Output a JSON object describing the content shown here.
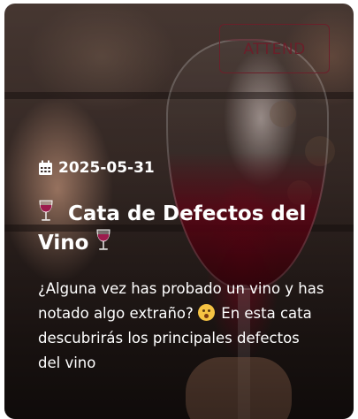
{
  "event": {
    "attend_label": "ATTEND",
    "date": "2025-05-31",
    "title_text": "Cata de Defectos del Vino",
    "description_part1": "¿Alguna vez has probado un vino y has notado algo extraño?",
    "description_part2": "En esta cata descubrirás los principales defectos del vino"
  },
  "icons": {
    "date": "calendar-icon",
    "title_left": "wine-glass-icon",
    "title_right": "wine-glass-icon",
    "description": "face-with-hand-over-mouth-icon"
  },
  "colors": {
    "attend_accent": "#6b1f2a",
    "text": "#ffffff",
    "wine": "#7a0a1e"
  }
}
